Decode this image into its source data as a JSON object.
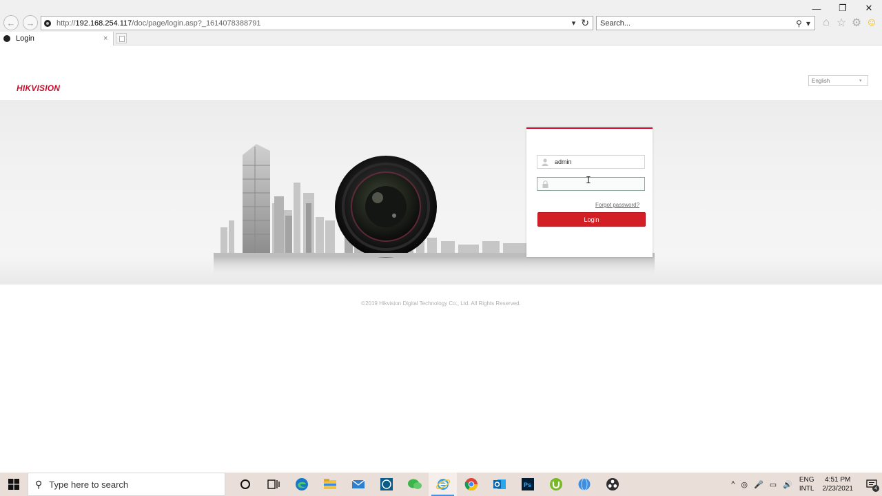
{
  "browser": {
    "url_prefix": "http://",
    "url_host": "192.168.254.117",
    "url_path": "/doc/page/login.asp?_1614078388791",
    "search_placeholder": "Search...",
    "tab_title": "Login",
    "tab_close": "×",
    "back_glyph": "←",
    "forward_glyph": "→",
    "minimize_glyph": "—",
    "restore_glyph": "❐",
    "close_glyph": "✕",
    "dropdown_glyph": "▾",
    "refresh_glyph": "↻",
    "search_glyph": "⚲",
    "home_glyph": "⌂",
    "favorites_glyph": "☆",
    "settings_glyph": "⚙",
    "feedback_glyph": "☺"
  },
  "page": {
    "logo": "HIKVISION",
    "language": "English",
    "language_caret": "▾",
    "username_value": "admin",
    "password_value": "",
    "forgot_password": "Forgot password?",
    "login_button": "Login",
    "copyright": "©2019 Hikvision Digital Technology Co., Ltd. All Rights Reserved."
  },
  "taskbar": {
    "search_placeholder": "Type here to search",
    "search_glyph": "⚲",
    "language_line1": "ENG",
    "language_line2": "INTL",
    "time": "4:51 PM",
    "date": "2/23/2021",
    "notification_count": "4",
    "tray_glyphs": [
      "^",
      "◎",
      "🎤",
      "▭",
      "🔊"
    ]
  },
  "colors": {
    "accent_red": "#d21f26",
    "taskbar_bg": "#eaded8"
  }
}
